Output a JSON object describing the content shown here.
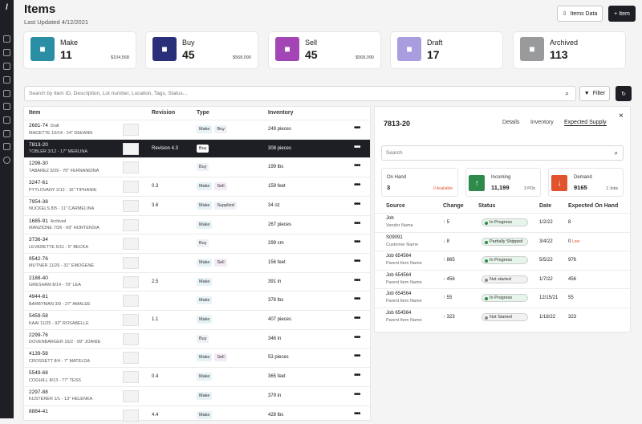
{
  "header": {
    "title": "Items",
    "subtitle": "Last Updated 4/12/2021",
    "items_data_label": "Items Data",
    "add_item_label": "+ Item"
  },
  "cards": [
    {
      "label": "Make",
      "count": "11",
      "amount": "$104,568",
      "color": "#2a8ea5",
      "icon": "gear-icon"
    },
    {
      "label": "Buy",
      "count": "45",
      "amount": "$568,090",
      "color": "#2a2f7a",
      "icon": "cart-icon"
    },
    {
      "label": "Sell",
      "count": "45",
      "amount": "$568,090",
      "color": "#a246b5",
      "icon": "card-icon"
    },
    {
      "label": "Draft",
      "count": "17",
      "amount": "",
      "color": "#a99de0",
      "icon": "document-icon"
    },
    {
      "label": "Archived",
      "count": "113",
      "amount": "",
      "color": "#999a9c",
      "icon": "archive-icon"
    }
  ],
  "search": {
    "placeholder": "Search by Item ID, Description, Lot number, Location, Tags, Status...",
    "filter_label": "Filter"
  },
  "table": {
    "headers": [
      "Item",
      "Revision",
      "Type",
      "Inventory"
    ],
    "rows": [
      {
        "id": "2681-74",
        "badge": "Draft",
        "name": "MAGETTE 10/14 - 24\" DEEANN",
        "rev": "",
        "types": [
          "Make",
          "Buy"
        ],
        "inv": "249 pieces"
      },
      {
        "id": "7813-20",
        "badge": "",
        "name": "TOBLER 3/12 - 17\" MERLINA",
        "rev": "Revision 4.3",
        "types": [
          "Buy"
        ],
        "inv": "308 pieces",
        "selected": true
      },
      {
        "id": "1298-30",
        "badge": "",
        "name": "TABAREZ 5/29 - 70\" FERNANDINA",
        "rev": "",
        "types": [
          "Buy"
        ],
        "inv": "199 lbs"
      },
      {
        "id": "3247-61",
        "badge": "",
        "name": "PYTLOVANY 2/12 - 16\" TIPHANIE",
        "rev": "0.3",
        "types": [
          "Make",
          "Sell"
        ],
        "inv": "159 feet"
      },
      {
        "id": "7954-38",
        "badge": "",
        "name": "NUCKELS 8/5 - 11\" CARMELINA",
        "rev": "3.6",
        "types": [
          "Make",
          "Supplied"
        ],
        "inv": "34 oz"
      },
      {
        "id": "1685-91",
        "badge": "Archived",
        "name": "MANZIONE 7/26 - 69\" HORTENSIA",
        "rev": "",
        "types": [
          "Make"
        ],
        "inv": "267 pieces"
      },
      {
        "id": "3736-34",
        "badge": "",
        "name": "LEVERETTE 5/11 - 5\" BECKA",
        "rev": "",
        "types": [
          "Buy"
        ],
        "inv": "299 cm"
      },
      {
        "id": "9542-76",
        "badge": "",
        "name": "MUTNER 11/26 - 31\" EMOGENE",
        "rev": "",
        "types": [
          "Make",
          "Sell"
        ],
        "inv": "156 feet"
      },
      {
        "id": "2188-40",
        "badge": "",
        "name": "GRESHAM 8/14 - 79\" LEA",
        "rev": "2.5",
        "types": [
          "Make"
        ],
        "inv": "391 in"
      },
      {
        "id": "4944-81",
        "badge": "",
        "name": "BARBYMAN 3/9 - 27\" AMALEE",
        "rev": "",
        "types": [
          "Make"
        ],
        "inv": "378 lbs"
      },
      {
        "id": "5459-58",
        "badge": "",
        "name": "KAAI 11/25 - 92\" ROSABELLE",
        "rev": "1.1",
        "types": [
          "Make"
        ],
        "inv": "407 pieces"
      },
      {
        "id": "2299-76",
        "badge": "",
        "name": "DOVENBARGER 10/2 - 99\" JOANIE",
        "rev": "",
        "types": [
          "Buy"
        ],
        "inv": "346 in"
      },
      {
        "id": "4139-58",
        "badge": "",
        "name": "CROSSETT 8/4 - 7\" MATELDA",
        "rev": "",
        "types": [
          "Make",
          "Sell"
        ],
        "inv": "53 pieces"
      },
      {
        "id": "5549-68",
        "badge": "",
        "name": "COGHILL 8/13 - 77\" TESS",
        "rev": "0.4",
        "types": [
          "Make"
        ],
        "inv": "365 feet"
      },
      {
        "id": "2297-88",
        "badge": "",
        "name": "KUSTERER 1/1 - 13\" HELENKA",
        "rev": "",
        "types": [
          "Make"
        ],
        "inv": "379 in"
      },
      {
        "id": "8884-41",
        "badge": "",
        "name": "",
        "rev": "4.4",
        "types": [
          "Make"
        ],
        "inv": "428 lbs"
      }
    ]
  },
  "panel": {
    "title": "7813-20",
    "tabs": [
      "Details",
      "Inventory",
      "Expected Supply"
    ],
    "search_placeholder": "Search",
    "on_hand": {
      "label": "On Hand",
      "value": "3",
      "sub": "0 Available"
    },
    "incoming": {
      "label": "Incoming",
      "value": "11,199",
      "sub": "3 POs"
    },
    "demand": {
      "label": "Demand",
      "value": "9165",
      "sub": "2 Jobs"
    },
    "headers": [
      "Source",
      "Change",
      "Status",
      "Date",
      "Expected On Hand"
    ],
    "rows": [
      {
        "a": "Job",
        "b": "Vendor Name",
        "chg": "5",
        "dir": "up",
        "status": "In Progress",
        "date": "1/2/22",
        "oh": "8"
      },
      {
        "a": "S09091",
        "b": "Customer Name",
        "chg": "8",
        "dir": "down",
        "status": "Partially Shipped",
        "date": "3/4/22",
        "oh": "0",
        "low": "Low"
      },
      {
        "a": "Job 654564",
        "b": "Parent Item Name",
        "chg": "865",
        "dir": "up",
        "status": "In Progress",
        "date": "5/5/22",
        "oh": "976"
      },
      {
        "a": "Job 654564",
        "b": "Parent Item Name",
        "chg": "456",
        "dir": "down",
        "status": "Not started",
        "date": "1/7/22",
        "oh": "456"
      },
      {
        "a": "Job 654564",
        "b": "Parent Item Name",
        "chg": "55",
        "dir": "up",
        "status": "In Progress",
        "date": "12/15/21",
        "oh": "55"
      },
      {
        "a": "Job 654564",
        "b": "Parent Item Name",
        "chg": "323",
        "dir": "up",
        "status": "Not Started",
        "date": "1/18/22",
        "oh": "323"
      }
    ]
  }
}
